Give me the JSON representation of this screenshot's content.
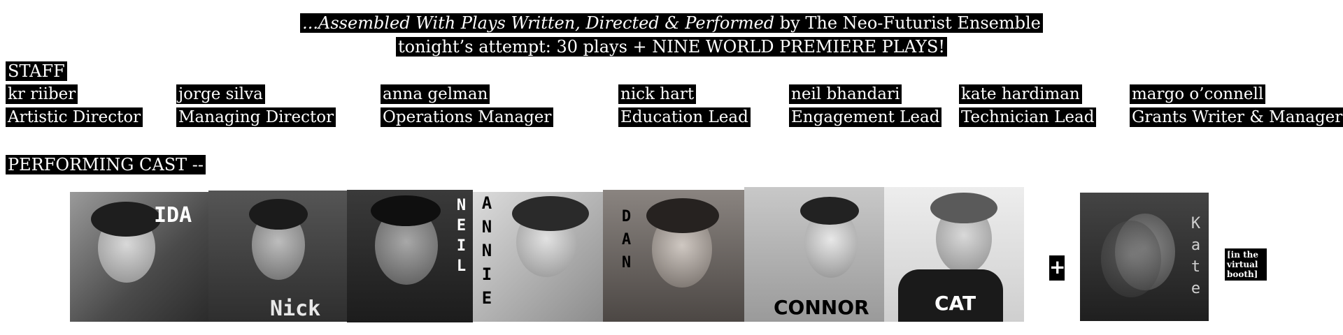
{
  "header": {
    "line1_italic": "...Assembled With Plays Written, Directed & Performed",
    "line1_rest": " by The Neo-Futurist Ensemble",
    "line2": "tonight’s attempt: 30 plays  +  NINE WORLD PREMIERE PLAYS!"
  },
  "staff": {
    "title": "STAFF",
    "members": [
      {
        "name": "kr  riiber",
        "role": "Artistic Director"
      },
      {
        "name": "jorge silva",
        "role": "Managing Director"
      },
      {
        "name": "anna gelman",
        "role": "Operations Manager"
      },
      {
        "name": "nick hart",
        "role": "Education Lead"
      },
      {
        "name": "neil bhandari",
        "role": "Engagement Lead"
      },
      {
        "name": "kate hardiman",
        "role": "Technician Lead"
      },
      {
        "name": "margo o’connell",
        "role": "Grants Writer & Manager"
      }
    ]
  },
  "cast": {
    "title": "PERFORMING CAST --",
    "photos": [
      {
        "label": "IDA"
      },
      {
        "label": "Nick"
      },
      {
        "label": "NEIL"
      },
      {
        "label": "ANNIE"
      },
      {
        "label": "DAN"
      },
      {
        "label": "CONNOR"
      },
      {
        "label": "CAT"
      }
    ],
    "plus": "+",
    "guest": {
      "label": "Kate",
      "note": "[in the virtual booth]"
    }
  },
  "colors": {
    "background": "#ffffff",
    "highlight": "#000000",
    "highlight_text": "#ffffff"
  }
}
